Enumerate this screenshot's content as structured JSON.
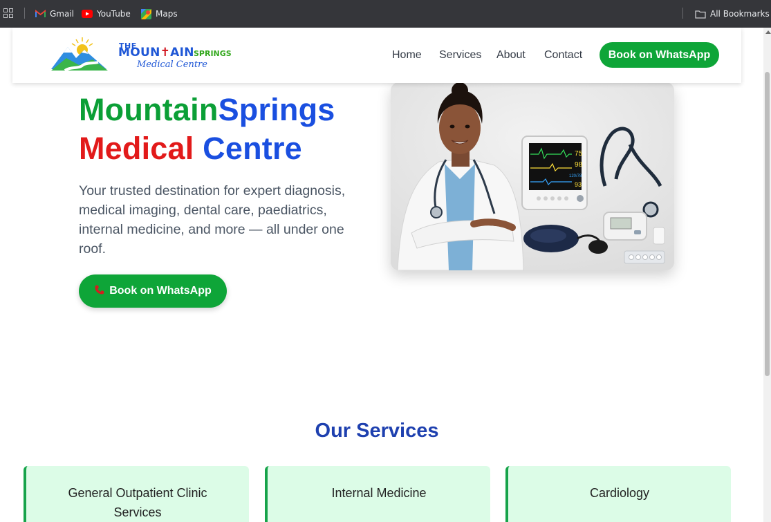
{
  "bookmarks_bar": {
    "items": [
      {
        "label": "Gmail",
        "icon": "gmail-icon"
      },
      {
        "label": "YouTube",
        "icon": "youtube-icon"
      },
      {
        "label": "Maps",
        "icon": "maps-icon"
      }
    ],
    "all_bookmarks": "All Bookmarks"
  },
  "header": {
    "logo": {
      "line1": "THE",
      "main_before": "MOUN",
      "main_cross": "✝",
      "main_after": "AIN",
      "springs": "SPRINGS",
      "subtitle": "Medical Centre"
    },
    "nav": {
      "home": "Home",
      "services": "Services",
      "about": "About",
      "contact": "Contact",
      "cta": "Book on WhatsApp"
    }
  },
  "hero": {
    "title_word1": "Mountain",
    "title_word2": "Springs",
    "title_word3": "Medical",
    "title_word4": "Centre",
    "description": "Your trusted destination for expert diagnosis, medical imaging, dental care, paediatrics, internal medicine, and more — all under one roof.",
    "cta": "Book on WhatsApp",
    "monitor_readings": [
      "75",
      "98",
      "120/78",
      "93"
    ]
  },
  "services": {
    "heading": "Our Services",
    "cards": [
      {
        "title_line1": "General Outpatient Clinic",
        "title_line2": "Services"
      },
      {
        "title_line1": "Internal Medicine",
        "title_line2": ""
      },
      {
        "title_line1": "Cardiology",
        "title_line2": ""
      }
    ]
  },
  "colors": {
    "brand_green": "#0ea538",
    "brand_blue": "#1a4fe0",
    "brand_red": "#e21a1a",
    "card_bg": "#dcfce7"
  }
}
